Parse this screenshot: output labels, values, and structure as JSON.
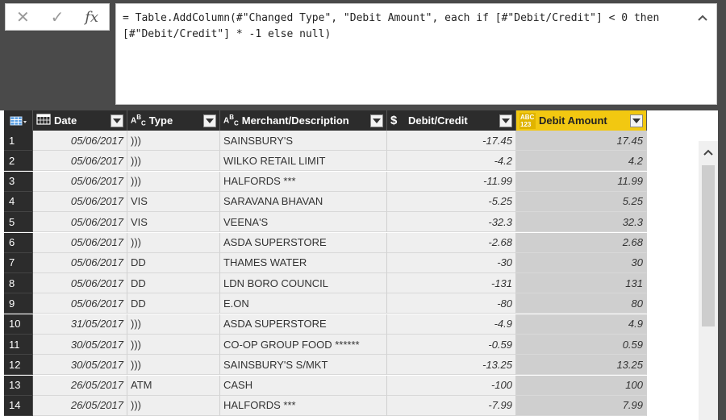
{
  "formula_bar": {
    "cancel_glyph": "✕",
    "confirm_glyph": "✓",
    "fx_label": "fx",
    "formula": "= Table.AddColumn(#\"Changed Type\", \"Debit Amount\", each if [#\"Debit/Credit\"] < 0 then\n[#\"Debit/Credit\"] * -1 else null)"
  },
  "columns": [
    {
      "key": "date",
      "label": "Date",
      "icon": "calendar-icon"
    },
    {
      "key": "type",
      "label": "Type",
      "icon": "text-type-icon"
    },
    {
      "key": "merchant",
      "label": "Merchant/Description",
      "icon": "text-type-icon"
    },
    {
      "key": "debit_credit",
      "label": "Debit/Credit",
      "icon": "currency-icon"
    },
    {
      "key": "debit_amount",
      "label": "Debit Amount",
      "icon": "any-type-icon"
    }
  ],
  "header_icon_text": {
    "text_type": "A B C",
    "currency": "$",
    "any_type": "ABC 123"
  },
  "rows": [
    {
      "num": "1",
      "date": "05/06/2017",
      "type": ")))",
      "merchant": "SAINSBURY'S",
      "debit_credit": "-17.45",
      "debit_amount": "17.45"
    },
    {
      "num": "2",
      "date": "05/06/2017",
      "type": ")))",
      "merchant": "WILKO RETAIL LIMIT",
      "debit_credit": "-4.2",
      "debit_amount": "4.2"
    },
    {
      "num": "3",
      "date": "05/06/2017",
      "type": ")))",
      "merchant": "HALFORDS ***",
      "debit_credit": "-11.99",
      "debit_amount": "11.99"
    },
    {
      "num": "4",
      "date": "05/06/2017",
      "type": "VIS",
      "merchant": "SARAVANA BHAVAN",
      "debit_credit": "-5.25",
      "debit_amount": "5.25"
    },
    {
      "num": "5",
      "date": "05/06/2017",
      "type": "VIS",
      "merchant": "VEENA'S",
      "debit_credit": "-32.3",
      "debit_amount": "32.3"
    },
    {
      "num": "6",
      "date": "05/06/2017",
      "type": ")))",
      "merchant": "ASDA SUPERSTORE",
      "debit_credit": "-2.68",
      "debit_amount": "2.68"
    },
    {
      "num": "7",
      "date": "05/06/2017",
      "type": "DD",
      "merchant": "THAMES WATER",
      "debit_credit": "-30",
      "debit_amount": "30"
    },
    {
      "num": "8",
      "date": "05/06/2017",
      "type": "DD",
      "merchant": "LDN BORO COUNCIL",
      "debit_credit": "-131",
      "debit_amount": "131"
    },
    {
      "num": "9",
      "date": "05/06/2017",
      "type": "DD",
      "merchant": "E.ON",
      "debit_credit": "-80",
      "debit_amount": "80"
    },
    {
      "num": "10",
      "date": "31/05/2017",
      "type": ")))",
      "merchant": "ASDA SUPERSTORE",
      "debit_credit": "-4.9",
      "debit_amount": "4.9"
    },
    {
      "num": "11",
      "date": "30/05/2017",
      "type": ")))",
      "merchant": "CO-OP GROUP FOOD  ******",
      "debit_credit": "-0.59",
      "debit_amount": "0.59"
    },
    {
      "num": "12",
      "date": "30/05/2017",
      "type": ")))",
      "merchant": "SAINSBURY'S S/MKT",
      "debit_credit": "-13.25",
      "debit_amount": "13.25"
    },
    {
      "num": "13",
      "date": "26/05/2017",
      "type": "ATM",
      "merchant": "CASH",
      "debit_credit": "-100",
      "debit_amount": "100"
    },
    {
      "num": "14",
      "date": "26/05/2017",
      "type": ")))",
      "merchant": "HALFORDS ***",
      "debit_credit": "-7.99",
      "debit_amount": "7.99"
    }
  ],
  "colors": {
    "header_bg": "#2c2c2c",
    "selected_header_bg": "#f2c811",
    "selected_column_bg": "#cfcfcf",
    "cell_bg": "#efefef"
  }
}
